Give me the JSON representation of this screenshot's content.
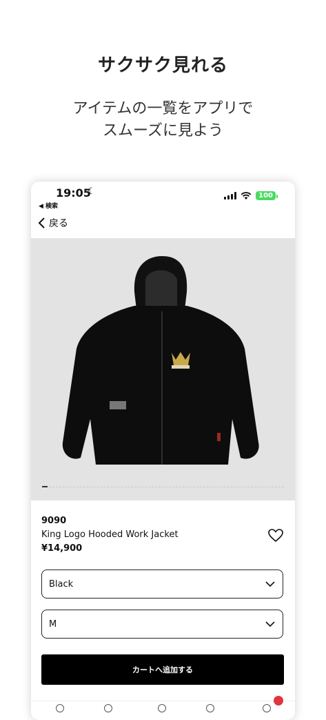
{
  "promo": {
    "title": "サクサク見れる",
    "subtitle_line1": "アイテムの一覧をアプリで",
    "subtitle_line2": "スムーズに見よう"
  },
  "status_bar": {
    "time": "19:05",
    "back_app": "◀ 検索",
    "battery": "100"
  },
  "nav": {
    "back_label": "戻る"
  },
  "product": {
    "brand": "9090",
    "name": "King Logo Hooded Work Jacket",
    "price": "¥14,900",
    "color_select": "Black",
    "size_select": "M"
  },
  "actions": {
    "add_to_cart": "カートへ追加する"
  },
  "colors": {
    "battery_green": "#4cd964",
    "image_bg": "#e3e3e3",
    "cart_button_bg": "#000000",
    "badge_red": "#e0363e"
  },
  "icons": [
    "moon-icon",
    "signal-icon",
    "wifi-icon",
    "battery-icon",
    "chevron-left-icon",
    "heart-icon",
    "chevron-down-icon"
  ]
}
